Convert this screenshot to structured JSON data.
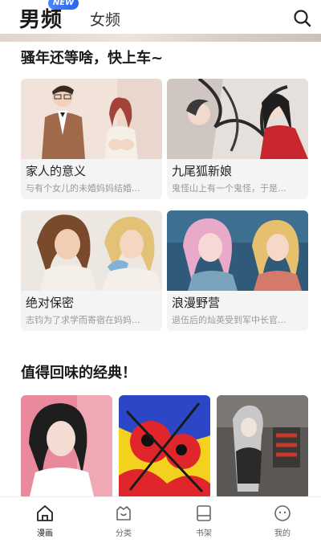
{
  "header": {
    "tab_active": "男频",
    "badge": "NEW",
    "tab_other": "女频",
    "search_icon": "search-icon"
  },
  "section1": {
    "title": "骚年还等啥，快上车~",
    "cards": [
      {
        "title": "家人的意义",
        "desc": "与有个女儿的未婚妈妈结婚..."
      },
      {
        "title": "九尾狐新娘",
        "desc": "鬼怪山上有一个鬼怪，于是..."
      },
      {
        "title": "绝对保密",
        "desc": "志钧为了求学而寄宿在妈妈..."
      },
      {
        "title": "浪漫野营",
        "desc": "退伍后的灿英受到军中长官..."
      }
    ]
  },
  "section2": {
    "title": "值得回味的经典！"
  },
  "bottom_nav": {
    "items": [
      {
        "label": "漫画",
        "icon": "home-icon",
        "active": true
      },
      {
        "label": "分类",
        "icon": "category-icon",
        "active": false
      },
      {
        "label": "书架",
        "icon": "bookshelf-icon",
        "active": false
      },
      {
        "label": "我的",
        "icon": "profile-icon",
        "active": false
      }
    ]
  },
  "colors": {
    "badge": "#2a64f0",
    "card_bg": "#f4f4f4",
    "desc_text": "#999999"
  }
}
